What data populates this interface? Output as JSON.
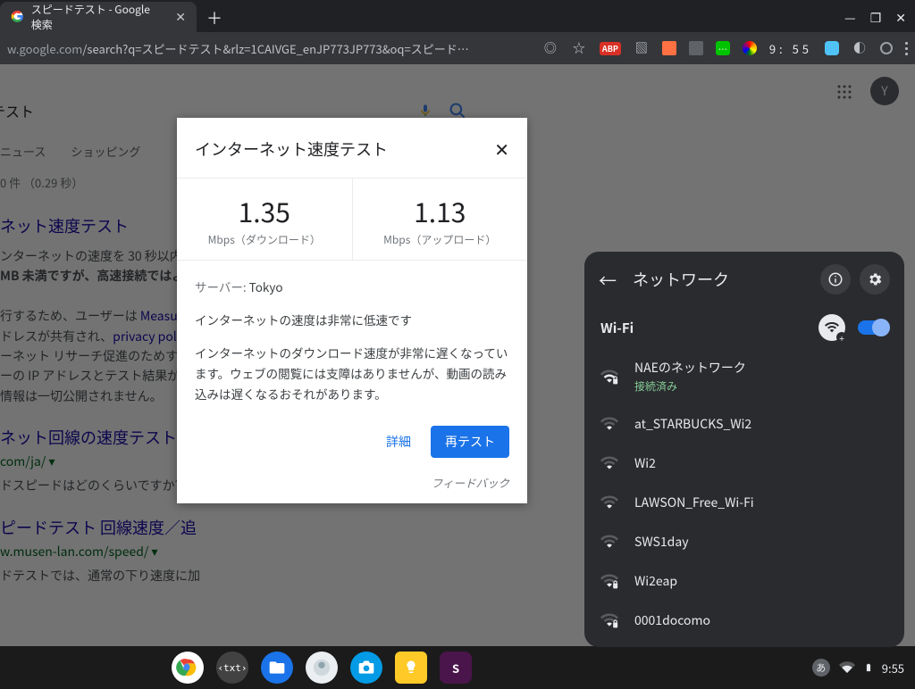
{
  "tab": {
    "title": "スピードテスト - Google 検索"
  },
  "omnibox": {
    "host": "w.google.com",
    "path": "/search?q=スピードテスト&rlz=1CAIVGE_enJP773JP773&oq=スピード…",
    "ext_badge": "ABP",
    "ext_time": "9:  55"
  },
  "search": {
    "query": "テスト",
    "tabs": [
      "ニュース",
      "ショッピング"
    ],
    "stats": "0 件 （0.29 秒）",
    "avatar_initial": "Y"
  },
  "results": {
    "r1_title": "ネット速度テスト",
    "r1_body_1": "ンターネットの速度を 30 秒以内",
    "r1_body_2": "MB 未満ですが、高速接続ではよ",
    "r1_body_3": "行するため、ユーザーは ",
    "r1_link_1": "Measure",
    "r1_body_4": "ドレスが共有され、",
    "r1_link_2": "privacy poli",
    "r1_body_5": "ーネット リサーチ促進のためす",
    "r1_body_6": "ーの IP アドレスとテスト結果が",
    "r1_body_7": "情報は一切公開されません。",
    "r2_title": "ネット回線の速度テスト",
    "r2_green": "com/ja/ ▾",
    "r2_body": "ドスピードはどのくらいですか? FA",
    "r3_title": "ピードテスト 回線速度／追",
    "r3_green": "w.musen-lan.com/speed/ ▾",
    "r3_body": "ドテストでは、通常の下り速度に加"
  },
  "dialog": {
    "title": "インターネット速度テスト",
    "download_value": "1.35",
    "download_label": "Mbps（ダウンロード）",
    "upload_value": "1.13",
    "upload_label": "Mbps（アップロード）",
    "server_label": "サーバー: ",
    "server_value": "Tokyo",
    "line1": "インターネットの速度は非常に低速です",
    "line2": "インターネットのダウンロード速度が非常に遅くなっています。ウェブの閲覧には支障はありませんが、動画の読み込みは遅くなるおそれがあります。",
    "details": "詳細",
    "retest": "再テスト",
    "feedback": "フィードバック"
  },
  "network": {
    "title": "ネットワーク",
    "section": "Wi-Fi",
    "connected_status": "接続済み",
    "items": [
      {
        "ssid": "NAEのネットワーク",
        "secure": true,
        "connected": true,
        "strength": 3
      },
      {
        "ssid": "at_STARBUCKS_Wi2",
        "secure": false,
        "strength": 2
      },
      {
        "ssid": "Wi2",
        "secure": false,
        "strength": 2
      },
      {
        "ssid": "LAWSON_Free_Wi-Fi",
        "secure": false,
        "strength": 2
      },
      {
        "ssid": "SWS1day",
        "secure": false,
        "strength": 2
      },
      {
        "ssid": "Wi2eap",
        "secure": true,
        "strength": 2
      },
      {
        "ssid": "0001docomo",
        "secure": true,
        "strength": 2
      }
    ]
  },
  "shelf": {
    "ime": "あ",
    "clock": "9:55"
  }
}
